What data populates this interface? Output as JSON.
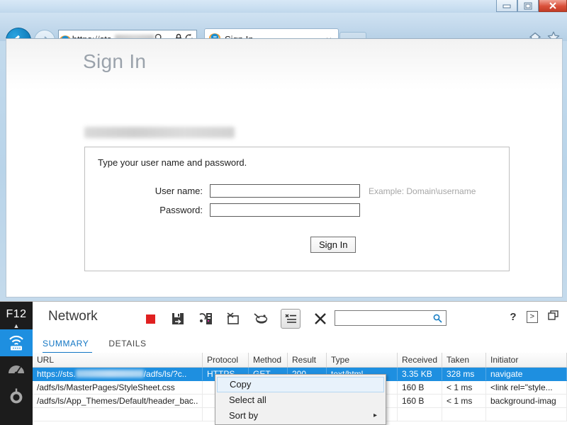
{
  "window": {
    "controls": [
      {
        "name": "minimize-button",
        "glyph": "minimize"
      },
      {
        "name": "maximize-button",
        "glyph": "maximize"
      },
      {
        "name": "close-button",
        "glyph": "close"
      }
    ]
  },
  "browser": {
    "back_label": "Back",
    "forward_label": "Forward",
    "address": {
      "scheme_text": "https",
      "separator": "://",
      "host_text": "sts.",
      "redacted": true,
      "icons": [
        "search-icon",
        "dropdown-arrow-icon",
        "lock-icon",
        "refresh-icon"
      ]
    },
    "tabs": [
      {
        "label": "Sign In",
        "close_label": "×",
        "active": true
      }
    ],
    "new_tab_label": "",
    "right_icons": [
      "home-icon",
      "favorites-star-icon"
    ]
  },
  "page": {
    "title": "Sign In",
    "subtitle_redacted": true,
    "form": {
      "hint": "Type your user name and password.",
      "username_label": "User name:",
      "username_value": "",
      "username_example": "Example: Domain\\username",
      "password_label": "Password:",
      "password_value": "",
      "submit_label": "Sign In"
    }
  },
  "devtools": {
    "rail": {
      "label": "F12",
      "caret": "▲",
      "items": [
        {
          "name": "network-tool-icon",
          "active": true
        },
        {
          "name": "performance-tool-icon",
          "active": false
        },
        {
          "name": "settings-gear-icon",
          "active": false
        }
      ]
    },
    "title": "Network",
    "toolbar": [
      {
        "name": "stop-capture-button",
        "label": "Stop capturing"
      },
      {
        "name": "save-har-button",
        "label": "Export as HAR"
      },
      {
        "name": "copy-server-button",
        "label": "Copy"
      },
      {
        "name": "clear-on-navigate-button",
        "label": "Clear on navigate"
      },
      {
        "name": "disable-cache-button",
        "label": "Always refresh from server"
      },
      {
        "name": "detail-view-toggle",
        "label": "Detail view",
        "pressed": true
      },
      {
        "name": "clear-entries-button",
        "label": "Clear"
      }
    ],
    "search": {
      "value": "",
      "placeholder": ""
    },
    "right_controls": [
      {
        "name": "help-button",
        "label": "?"
      },
      {
        "name": "console-toggle-button",
        "label": ">"
      },
      {
        "name": "undock-button",
        "label": ""
      }
    ],
    "tabs": [
      {
        "label": "SUMMARY",
        "selected": true
      },
      {
        "label": "DETAILS",
        "selected": false
      }
    ],
    "table": {
      "columns": [
        "URL",
        "Protocol",
        "Method",
        "Result",
        "Type",
        "Received",
        "Taken",
        "Initiator"
      ],
      "rows": [
        {
          "selected": true,
          "url_prefix": "https://sts.",
          "url_redacted": true,
          "url_suffix": "/adfs/ls/?c..",
          "protocol": "HTTPS",
          "method": "GET",
          "result": "200",
          "type": "text/html",
          "received": "3.35 KB",
          "taken": "328 ms",
          "initiator": "navigate"
        },
        {
          "selected": false,
          "url_prefix": "/adfs/ls/MasterPages/StyleSheet.css",
          "url_redacted": false,
          "url_suffix": "",
          "protocol": "",
          "method": "",
          "result": "",
          "type": "",
          "received": "160 B",
          "taken": "< 1 ms",
          "initiator": "<link rel=\"style..."
        },
        {
          "selected": false,
          "url_prefix": "/adfs/ls/App_Themes/Default/header_bac..",
          "url_redacted": false,
          "url_suffix": "",
          "protocol": "",
          "method": "",
          "result": "",
          "type": "",
          "received": "160 B",
          "taken": "< 1 ms",
          "initiator": "background-imag"
        },
        {
          "selected": false,
          "url_prefix": "",
          "url_redacted": false,
          "url_suffix": "",
          "protocol": "",
          "method": "",
          "result": "",
          "type": "",
          "received": "",
          "taken": "",
          "initiator": ""
        }
      ]
    },
    "context_menu": {
      "items": [
        {
          "label": "Copy",
          "highlighted": true,
          "submenu": false
        },
        {
          "label": "Select all",
          "highlighted": false,
          "submenu": false
        },
        {
          "label": "Sort by",
          "highlighted": false,
          "submenu": true
        }
      ],
      "submenu_arrow": "▸"
    }
  },
  "colors": {
    "accent_blue": "#1e8fe0",
    "link_blue": "#1276c4",
    "stop_red": "#e02020",
    "rail_dark": "#1c1c1c"
  }
}
